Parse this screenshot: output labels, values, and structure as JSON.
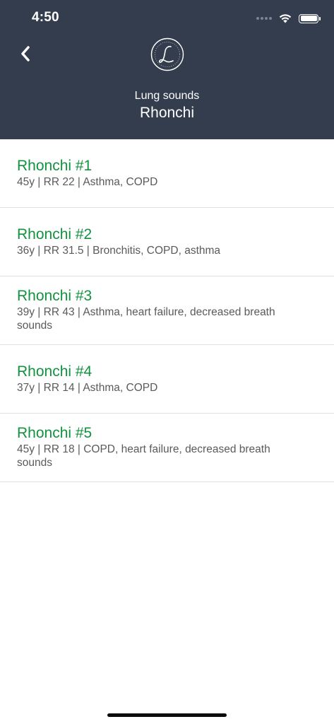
{
  "status_bar": {
    "time": "4:50"
  },
  "header": {
    "subtitle": "Lung sounds",
    "title": "Rhonchi",
    "back_icon": "chevron-left-icon",
    "logo_icon": "littmann-logo-icon",
    "background": "#333d4e"
  },
  "colors": {
    "accent": "#12923e",
    "secondary_text": "#5a5a5a",
    "divider": "#e1e1e1"
  },
  "list": {
    "items": [
      {
        "title": "Rhonchi #1",
        "detail": "45y | RR 22 | Asthma, COPD"
      },
      {
        "title": "Rhonchi #2",
        "detail": "36y | RR 31.5 | Bronchitis, COPD, asthma"
      },
      {
        "title": "Rhonchi #3",
        "detail": "39y | RR 43 | Asthma, heart failure, decreased breath sounds"
      },
      {
        "title": "Rhonchi #4",
        "detail": "37y | RR 14 | Asthma, COPD"
      },
      {
        "title": "Rhonchi #5",
        "detail": "45y | RR 18 | COPD, heart failure, decreased breath sounds"
      }
    ]
  }
}
